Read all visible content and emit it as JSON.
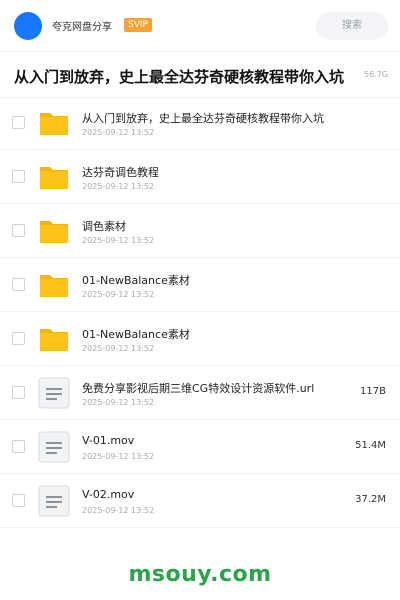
{
  "header": {
    "account_name": "夸克网盘分享",
    "badge": "SVIP",
    "search_label": "搜索"
  },
  "title_bar": {
    "title": "从入门到放弃，史上最全达芬奇硬核教程带你入坑",
    "meta": "56.7G"
  },
  "files": [
    {
      "name": "从入门到放弃，史上最全达芬奇硬核教程带你入坑",
      "date": "2025-09-12 13:52",
      "size": "",
      "icon": "folder-icon"
    },
    {
      "name": "达芬奇调色教程",
      "date": "2025-09-12 13:52",
      "size": "",
      "icon": "folder-icon"
    },
    {
      "name": "调色素材",
      "date": "2025-09-12 13:52",
      "size": "",
      "icon": "folder-icon"
    },
    {
      "name": "01-NewBalance素材",
      "date": "2025-09-12 13:52",
      "size": "",
      "icon": "folder-icon"
    },
    {
      "name": "01-NewBalance素材",
      "date": "2025-09-12 13:52",
      "size": "",
      "icon": "folder-icon"
    },
    {
      "name": "免费分享影视后期三维CG特效设计资源软件.url",
      "date": "2025-09-12 13:52",
      "size": "117B",
      "icon": "file-icon"
    },
    {
      "name": "V-01.mov",
      "date": "2025-09-12 13:52",
      "size": "51.4M",
      "icon": "file-icon"
    },
    {
      "name": "V-02.mov",
      "date": "2025-09-12 13:52",
      "size": "37.2M",
      "icon": "file-icon"
    }
  ],
  "watermark": "msouy.com",
  "colors": {
    "accent": "#1677ff",
    "badge": "#f7a233",
    "folder": "#fcc419",
    "watermark": "#2aa34a"
  }
}
